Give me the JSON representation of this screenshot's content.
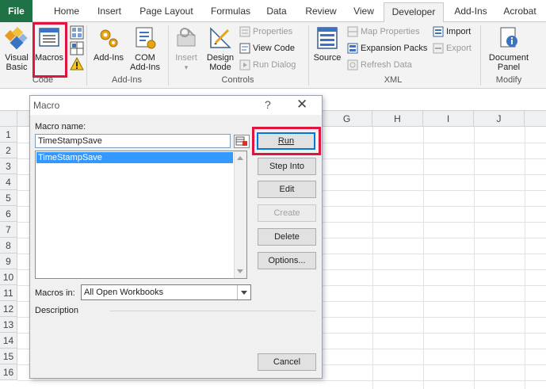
{
  "tabs": [
    {
      "label": "File"
    },
    {
      "label": "Home"
    },
    {
      "label": "Insert"
    },
    {
      "label": "Page Layout"
    },
    {
      "label": "Formulas"
    },
    {
      "label": "Data"
    },
    {
      "label": "Review"
    },
    {
      "label": "View"
    },
    {
      "label": "Developer"
    },
    {
      "label": "Add-Ins"
    },
    {
      "label": "Acrobat"
    }
  ],
  "ribbon": {
    "code": {
      "visual_basic": "Visual Basic",
      "visual_basic_l1": "Visual",
      "visual_basic_l2": "Basic",
      "macros": "Macros",
      "group": "Code"
    },
    "addins": {
      "addins": "Add-Ins",
      "com_l1": "COM",
      "com_l2": "Add-Ins",
      "group": "Add-Ins"
    },
    "controls": {
      "insert": "Insert",
      "design_l1": "Design",
      "design_l2": "Mode",
      "properties": "Properties",
      "view_code": "View Code",
      "run_dialog": "Run Dialog",
      "group": "Controls"
    },
    "xml": {
      "source": "Source",
      "map_properties": "Map Properties",
      "expansion_packs": "Expansion Packs",
      "refresh_data": "Refresh Data",
      "import": "Import",
      "export": "Export",
      "group": "XML"
    },
    "modify": {
      "doc_l1": "Document",
      "doc_l2": "Panel",
      "group": "Modify"
    }
  },
  "sheet": {
    "columns": [
      "G",
      "H",
      "I",
      "J"
    ],
    "rows": [
      "1",
      "2",
      "3",
      "4",
      "5",
      "6",
      "7",
      "8",
      "9",
      "10",
      "11",
      "12",
      "13",
      "14",
      "15",
      "16"
    ]
  },
  "dialog": {
    "title": "Macro",
    "help": "?",
    "close": "✕",
    "macro_name_label": "Macro name:",
    "macro_name_value": "TimeStampSave",
    "list_items": [
      "TimeStampSave"
    ],
    "macros_in_label": "Macros in:",
    "macros_in_value": "All Open Workbooks",
    "description_label": "Description",
    "buttons": {
      "run": "Run",
      "step_into": "Step Into",
      "edit": "Edit",
      "create": "Create",
      "delete": "Delete",
      "options": "Options...",
      "cancel": "Cancel"
    }
  },
  "colors": {
    "file_tab": "#1f7245",
    "highlight": "#e0143c",
    "selection": "#3399ff"
  }
}
